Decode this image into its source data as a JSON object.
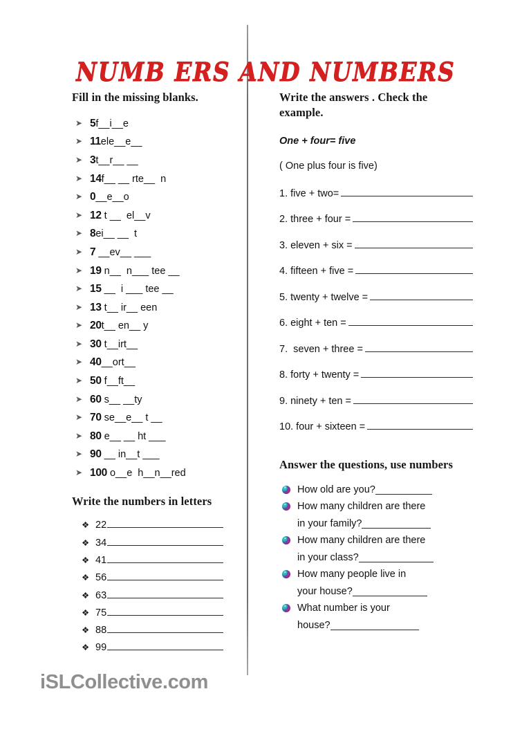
{
  "title": "NUMB ERS AND NUMBERS",
  "title_color": "#d52020",
  "left": {
    "heading": "Fill in the missing blanks.",
    "bullet_icon": "arrow-bullet",
    "items": [
      {
        "number": "5",
        "word": "f__i__e"
      },
      {
        "number": "11",
        "word": "ele__e__"
      },
      {
        "number": "3",
        "word": "t__r__ __"
      },
      {
        "number": "14",
        "word": "f__ __ rte__  n"
      },
      {
        "number": "0",
        "word": "__e__o"
      },
      {
        "number": "12",
        "word": " t __  el__v"
      },
      {
        "number": "8",
        "word": "ei__ __  t"
      },
      {
        "number": "7",
        "word": " __ev__ ___"
      },
      {
        "number": "19",
        "word": " n__  n___ tee __"
      },
      {
        "number": "15",
        "word": " __  i ___ tee __"
      },
      {
        "number": "13",
        "word": " t__ ir__ een"
      },
      {
        "number": "20",
        "word": "t__ en__ y"
      },
      {
        "number": "30",
        "word": " t__irt__"
      },
      {
        "number": "40",
        "word": "__ort__"
      },
      {
        "number": "50",
        "word": " f__ft__"
      },
      {
        "number": "60",
        "word": " s__ __ty"
      },
      {
        "number": "70",
        "word": " se__e__ t __"
      },
      {
        "number": "80",
        "word": " e__ __ ht ___"
      },
      {
        "number": "90",
        "word": " __ in__t ___"
      },
      {
        "number": "100",
        "word": " o__e  h__n__red"
      }
    ],
    "letters_heading": "Write the numbers in letters",
    "diamond_icon": "diamond-bullet",
    "letter_numbers": [
      "22",
      "34",
      "41",
      "56",
      "63",
      "75",
      "88",
      "99"
    ]
  },
  "right": {
    "heading": "Write the answers . Check the example.",
    "example_italic": "One + four= five",
    "example_plain": "( One plus four is five)",
    "problems": [
      "1. five + two=",
      "2. three + four =",
      "3. eleven + six =",
      "4. fifteen + five =",
      "5. twenty + twelve =",
      "6. eight + ten =",
      "7.  seven + three =",
      "8. forty + twenty =",
      "9. ninety + ten =",
      "10. four + sixteen ="
    ],
    "answer_heading": "Answer the questions, use numbers",
    "globe_icon": "globe-bullet",
    "questions": [
      {
        "line1": "How old are you?",
        "line2": ""
      },
      {
        "line1": "How many children are there",
        "line2": "in your family?"
      },
      {
        "line1": "How many children are there",
        "line2": "in your class?"
      },
      {
        "line1": "How many people live in",
        "line2": "your house?"
      },
      {
        "line1": "What number is your",
        "line2": "house?"
      }
    ]
  },
  "footer": "iSLCollective.com"
}
